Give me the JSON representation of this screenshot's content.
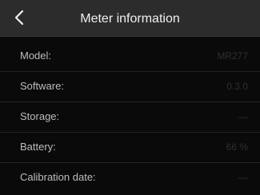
{
  "header": {
    "title": "Meter information",
    "back_icon": "chevron-left-icon"
  },
  "rows": [
    {
      "label": "Model:",
      "value": "MR277"
    },
    {
      "label": "Software:",
      "value": "0.3.0"
    },
    {
      "label": "Storage:",
      "value": "—"
    },
    {
      "label": "Battery:",
      "value": "66 %"
    },
    {
      "label": "Calibration date:",
      "value": "—"
    }
  ],
  "colors": {
    "background": "#0a0a0a",
    "header_background": "#2c2c2c",
    "label_text": "#bdbdbd",
    "value_text": "#2f2f2f",
    "divider": "#242424"
  }
}
